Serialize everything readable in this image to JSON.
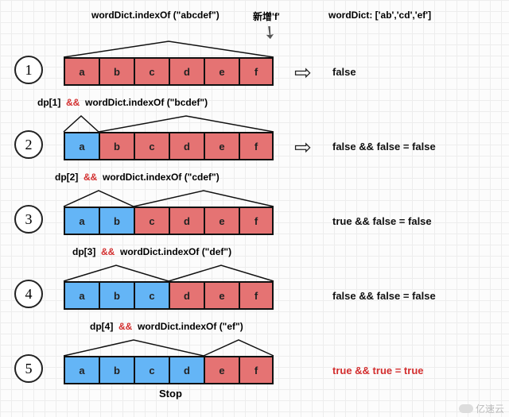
{
  "header": {
    "call_label": "wordDict.indexOf (\"abcdef\")",
    "new_label": "新增'f'",
    "dict_label": "wordDict: ['ab','cd','ef']"
  },
  "rows": [
    {
      "num": "1",
      "dp_label": "",
      "call_label": "",
      "cells": [
        "a",
        "b",
        "c",
        "d",
        "e",
        "f"
      ],
      "colors": [
        "red",
        "red",
        "red",
        "red",
        "red",
        "red"
      ],
      "split": 0,
      "result": "false",
      "result_red": false,
      "show_arrow": true
    },
    {
      "num": "2",
      "dp_label": "dp[1]",
      "call_label": "wordDict.indexOf (\"bcdef\")",
      "cells": [
        "a",
        "b",
        "c",
        "d",
        "e",
        "f"
      ],
      "colors": [
        "blue",
        "red",
        "red",
        "red",
        "red",
        "red"
      ],
      "split": 1,
      "result": "false && false = false",
      "result_red": false,
      "show_arrow": true
    },
    {
      "num": "3",
      "dp_label": "dp[2]",
      "call_label": "wordDict.indexOf (\"cdef\")",
      "cells": [
        "a",
        "b",
        "c",
        "d",
        "e",
        "f"
      ],
      "colors": [
        "blue",
        "blue",
        "red",
        "red",
        "red",
        "red"
      ],
      "split": 2,
      "result": "true && false = false",
      "result_red": false,
      "show_arrow": false
    },
    {
      "num": "4",
      "dp_label": "dp[3]",
      "call_label": "wordDict.indexOf (\"def\")",
      "cells": [
        "a",
        "b",
        "c",
        "d",
        "e",
        "f"
      ],
      "colors": [
        "blue",
        "blue",
        "blue",
        "red",
        "red",
        "red"
      ],
      "split": 3,
      "result": "false && false = false",
      "result_red": false,
      "show_arrow": false
    },
    {
      "num": "5",
      "dp_label": "dp[4]",
      "call_label": "wordDict.indexOf (\"ef\")",
      "cells": [
        "a",
        "b",
        "c",
        "d",
        "e",
        "f"
      ],
      "colors": [
        "blue",
        "blue",
        "blue",
        "blue",
        "red",
        "red"
      ],
      "split": 4,
      "result": "true && true = true",
      "result_red": true,
      "show_arrow": false
    }
  ],
  "and_symbol": "&&",
  "stop_label": "Stop",
  "watermark": "亿速云"
}
